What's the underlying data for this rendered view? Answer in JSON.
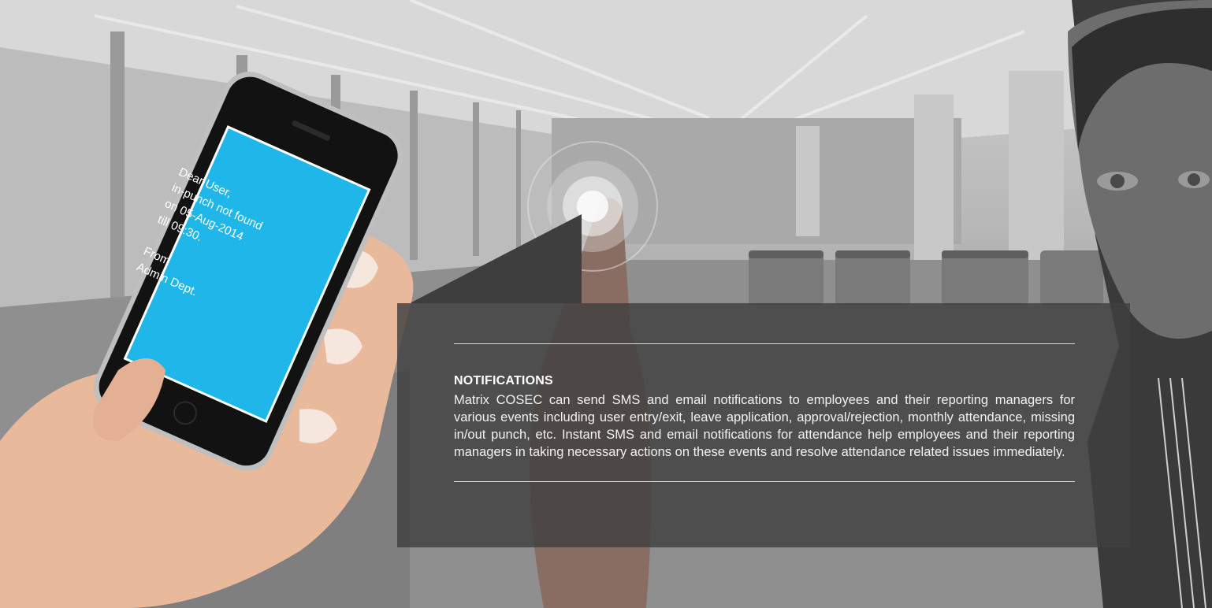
{
  "phone": {
    "message": {
      "greeting": "Dear User,",
      "line1": "in-punch not found",
      "line2": "on 05-Aug-2014",
      "line3": "till 09:30.",
      "from": "From",
      "dept": "Admin Dept."
    },
    "screen_color": "#1fb6ea"
  },
  "panel": {
    "title": "NOTIFICATIONS",
    "body": "Matrix COSEC can send SMS and email notifications to employees and their reporting managers for various events including user entry/exit, leave application, approval/rejection, monthly attendance, missing in/out punch, etc. Instant SMS and email notifications for attendance help employees and their reporting managers in taking necessary actions on these events and resolve attendance related issues immediately."
  }
}
